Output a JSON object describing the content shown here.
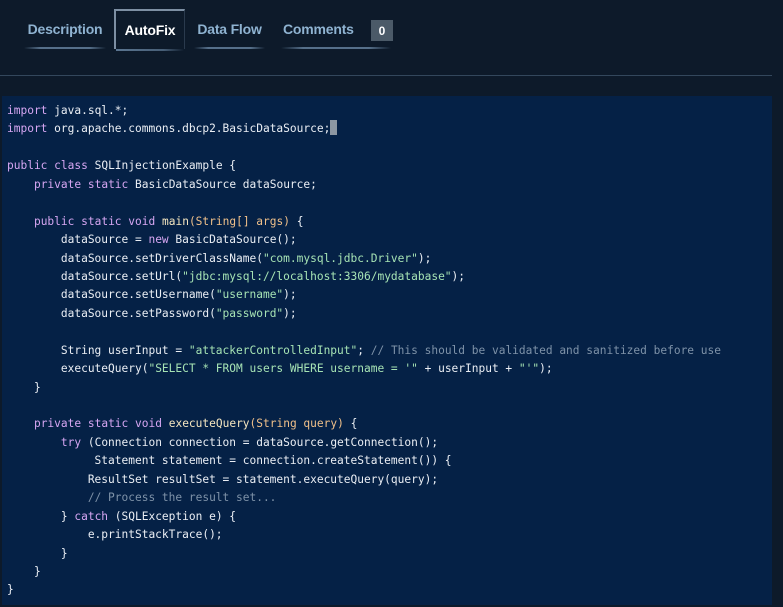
{
  "tabs": [
    {
      "label": "Description",
      "active": false
    },
    {
      "label": "AutoFix",
      "active": true
    },
    {
      "label": "Data Flow",
      "active": false
    },
    {
      "label": "Comments",
      "active": false
    }
  ],
  "comments_count": "0",
  "code_lines": [
    [
      {
        "t": "import",
        "c": "kw"
      },
      {
        "t": " java.sql.*;",
        "c": "id"
      }
    ],
    [
      {
        "t": "import",
        "c": "kw"
      },
      {
        "t": " org.apache.commons.dbcp2.BasicDataSource;",
        "c": "id"
      },
      {
        "t": "",
        "c": "cursor"
      }
    ],
    [],
    [
      {
        "t": "public",
        "c": "kw"
      },
      {
        "t": " ",
        "c": "id"
      },
      {
        "t": "class",
        "c": "kw"
      },
      {
        "t": " SQLInjectionExample {",
        "c": "id"
      }
    ],
    [
      {
        "t": "    ",
        "c": "id"
      },
      {
        "t": "private",
        "c": "kw"
      },
      {
        "t": " ",
        "c": "id"
      },
      {
        "t": "static",
        "c": "kw"
      },
      {
        "t": " BasicDataSource dataSource;",
        "c": "id"
      }
    ],
    [],
    [
      {
        "t": "    ",
        "c": "id"
      },
      {
        "t": "public",
        "c": "kw"
      },
      {
        "t": " ",
        "c": "id"
      },
      {
        "t": "static",
        "c": "kw"
      },
      {
        "t": " ",
        "c": "id"
      },
      {
        "t": "void",
        "c": "kw"
      },
      {
        "t": " main",
        "c": "fn"
      },
      {
        "t": "(String[] args)",
        "c": "type"
      },
      {
        "t": " {",
        "c": "id"
      }
    ],
    [
      {
        "t": "        dataSource = ",
        "c": "id"
      },
      {
        "t": "new",
        "c": "kw"
      },
      {
        "t": " BasicDataSource();",
        "c": "id"
      }
    ],
    [
      {
        "t": "        dataSource.setDriverClassName(",
        "c": "id"
      },
      {
        "t": "\"com.mysql.jdbc.Driver\"",
        "c": "str"
      },
      {
        "t": ");",
        "c": "id"
      }
    ],
    [
      {
        "t": "        dataSource.setUrl(",
        "c": "id"
      },
      {
        "t": "\"jdbc:mysql://localhost:3306/mydatabase\"",
        "c": "str"
      },
      {
        "t": ");",
        "c": "id"
      }
    ],
    [
      {
        "t": "        dataSource.setUsername(",
        "c": "id"
      },
      {
        "t": "\"username\"",
        "c": "str"
      },
      {
        "t": ");",
        "c": "id"
      }
    ],
    [
      {
        "t": "        dataSource.setPassword(",
        "c": "id"
      },
      {
        "t": "\"password\"",
        "c": "str"
      },
      {
        "t": ");",
        "c": "id"
      }
    ],
    [],
    [
      {
        "t": "        String userInput = ",
        "c": "id"
      },
      {
        "t": "\"attackerControlledInput\"",
        "c": "str"
      },
      {
        "t": "; ",
        "c": "id"
      },
      {
        "t": "// This should be validated and sanitized before use",
        "c": "com"
      }
    ],
    [
      {
        "t": "        executeQuery(",
        "c": "id"
      },
      {
        "t": "\"SELECT * FROM users WHERE username = '\"",
        "c": "str"
      },
      {
        "t": " + userInput + ",
        "c": "id"
      },
      {
        "t": "\"'\"",
        "c": "str"
      },
      {
        "t": ");",
        "c": "id"
      }
    ],
    [
      {
        "t": "    }",
        "c": "id"
      }
    ],
    [],
    [
      {
        "t": "    ",
        "c": "id"
      },
      {
        "t": "private",
        "c": "kw"
      },
      {
        "t": " ",
        "c": "id"
      },
      {
        "t": "static",
        "c": "kw"
      },
      {
        "t": " ",
        "c": "id"
      },
      {
        "t": "void",
        "c": "kw"
      },
      {
        "t": " executeQuery",
        "c": "fn"
      },
      {
        "t": "(String query)",
        "c": "type"
      },
      {
        "t": " {",
        "c": "id"
      }
    ],
    [
      {
        "t": "        ",
        "c": "id"
      },
      {
        "t": "try",
        "c": "kw"
      },
      {
        "t": " (Connection connection = dataSource.getConnection();",
        "c": "id"
      }
    ],
    [
      {
        "t": "             Statement statement = connection.createStatement()) {",
        "c": "id"
      }
    ],
    [
      {
        "t": "            ResultSet resultSet = statement.executeQuery(query);",
        "c": "id"
      }
    ],
    [
      {
        "t": "            ",
        "c": "id"
      },
      {
        "t": "// Process the result set...",
        "c": "com"
      }
    ],
    [
      {
        "t": "        } ",
        "c": "id"
      },
      {
        "t": "catch",
        "c": "kw"
      },
      {
        "t": " (SQLException e) {",
        "c": "id"
      }
    ],
    [
      {
        "t": "            e.printStackTrace();",
        "c": "id"
      }
    ],
    [
      {
        "t": "        }",
        "c": "id"
      }
    ],
    [
      {
        "t": "    }",
        "c": "id"
      }
    ],
    [
      {
        "t": "}",
        "c": "id"
      }
    ]
  ]
}
